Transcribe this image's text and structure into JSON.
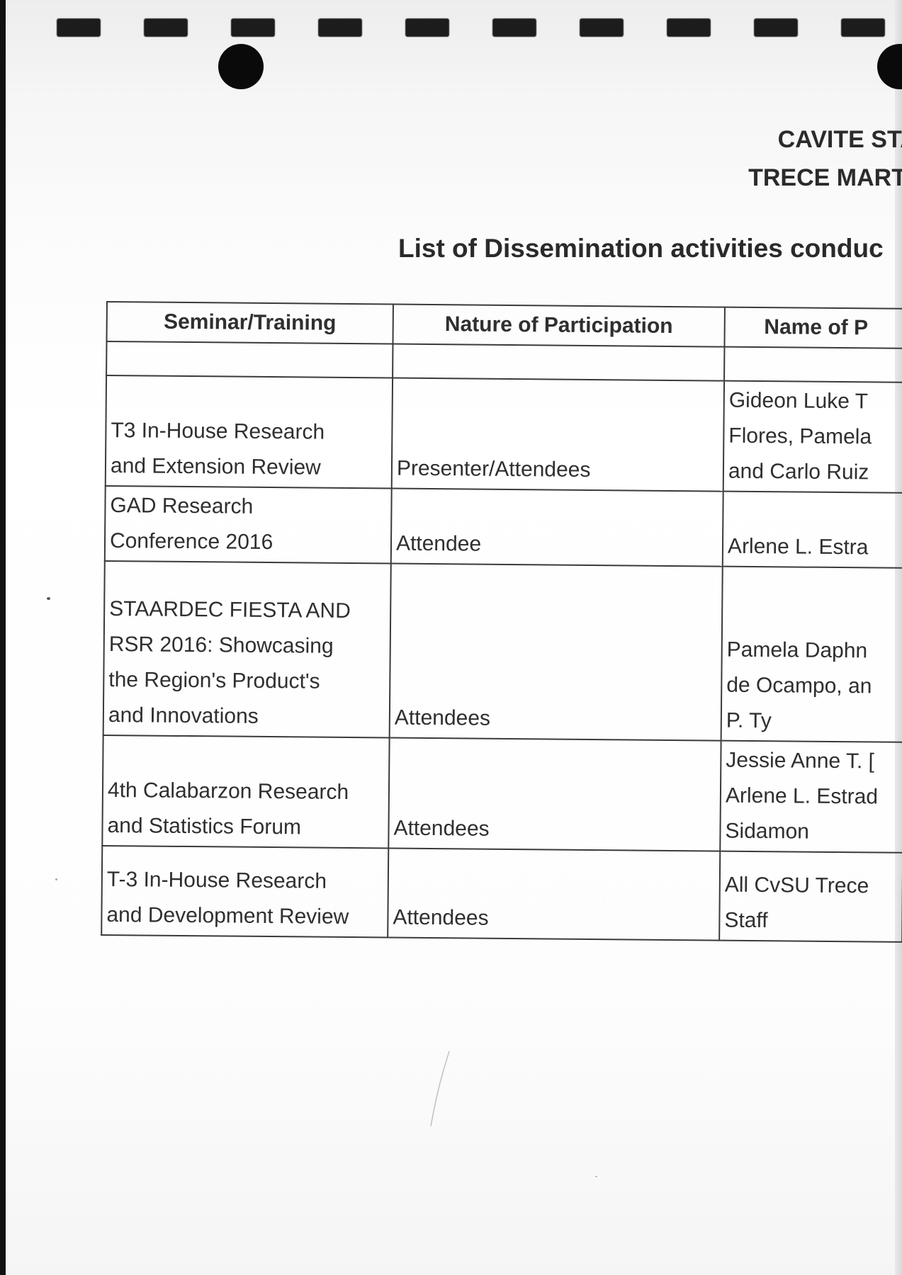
{
  "header": {
    "line1": "CAVITE STAT",
    "line2": "TRECE MARTIR"
  },
  "title": "List of Dissemination activities conduc",
  "table": {
    "headers": [
      "Seminar/Training",
      "Nature of Participation",
      "Name of P"
    ],
    "rows": [
      {
        "seminar": [
          "T3 In-House Research",
          "and Extension Review"
        ],
        "participation": "Presenter/Attendees",
        "names": [
          "Gideon Luke T",
          "Flores, Pamela",
          "and Carlo Ruiz"
        ]
      },
      {
        "seminar": [
          "GAD Research",
          "Conference 2016"
        ],
        "participation": "Attendee",
        "names": [
          "Arlene L. Estra"
        ]
      },
      {
        "seminar": [
          "STAARDEC FIESTA AND",
          "RSR 2016: Showcasing",
          "the Region's Product's",
          "and Innovations"
        ],
        "participation": "Attendees",
        "names": [
          "Pamela Daphn",
          "de Ocampo, an",
          "P. Ty"
        ]
      },
      {
        "seminar": [
          "4th Calabarzon Research",
          "and Statistics Forum"
        ],
        "participation": "Attendees",
        "names": [
          "Jessie Anne T. [",
          "Arlene L. Estrad",
          "Sidamon"
        ]
      },
      {
        "seminar": [
          "T-3 In-House Research",
          "and Development Review"
        ],
        "participation": "Attendees",
        "names": [
          "All CvSU Trece",
          "Staff"
        ]
      }
    ]
  }
}
